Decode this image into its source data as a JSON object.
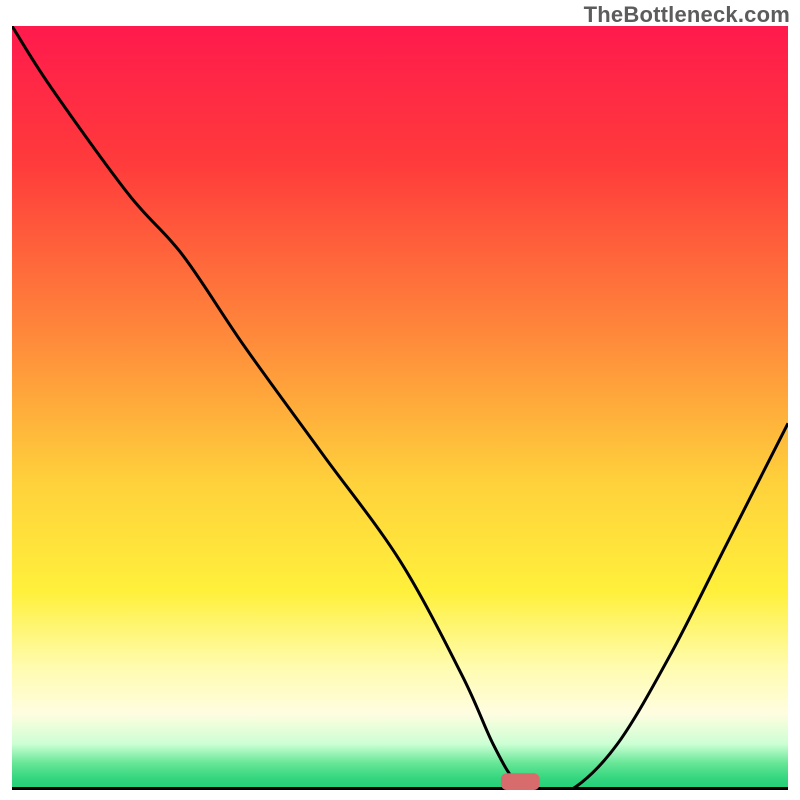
{
  "watermark": "TheBottleneck.com",
  "chart_data": {
    "type": "line",
    "title": "",
    "xlabel": "",
    "ylabel": "",
    "xlim": [
      0,
      100
    ],
    "ylim": [
      0,
      100
    ],
    "grid": false,
    "series": [
      {
        "name": "bottleneck-curve",
        "x": [
          0,
          5,
          15,
          22,
          30,
          40,
          50,
          58,
          62,
          65,
          68,
          72,
          78,
          85,
          92,
          100
        ],
        "values": [
          100,
          92,
          78,
          70,
          58,
          44,
          30,
          15,
          6,
          1,
          0,
          0,
          6,
          18,
          32,
          48
        ]
      }
    ],
    "marker": {
      "x": 65.5,
      "y": 0,
      "width": 5,
      "height": 2.2,
      "color": "#d86b6b"
    },
    "gradient_stops": [
      {
        "offset": 0.0,
        "color": "#ff1a4d"
      },
      {
        "offset": 0.18,
        "color": "#ff3b3b"
      },
      {
        "offset": 0.4,
        "color": "#ff873b"
      },
      {
        "offset": 0.6,
        "color": "#ffd23b"
      },
      {
        "offset": 0.74,
        "color": "#fff03b"
      },
      {
        "offset": 0.84,
        "color": "#fffcb0"
      },
      {
        "offset": 0.9,
        "color": "#fffde0"
      },
      {
        "offset": 0.94,
        "color": "#ccffd4"
      },
      {
        "offset": 0.965,
        "color": "#66e696"
      },
      {
        "offset": 0.985,
        "color": "#33d67e"
      },
      {
        "offset": 1.0,
        "color": "#1fcf78"
      }
    ]
  }
}
